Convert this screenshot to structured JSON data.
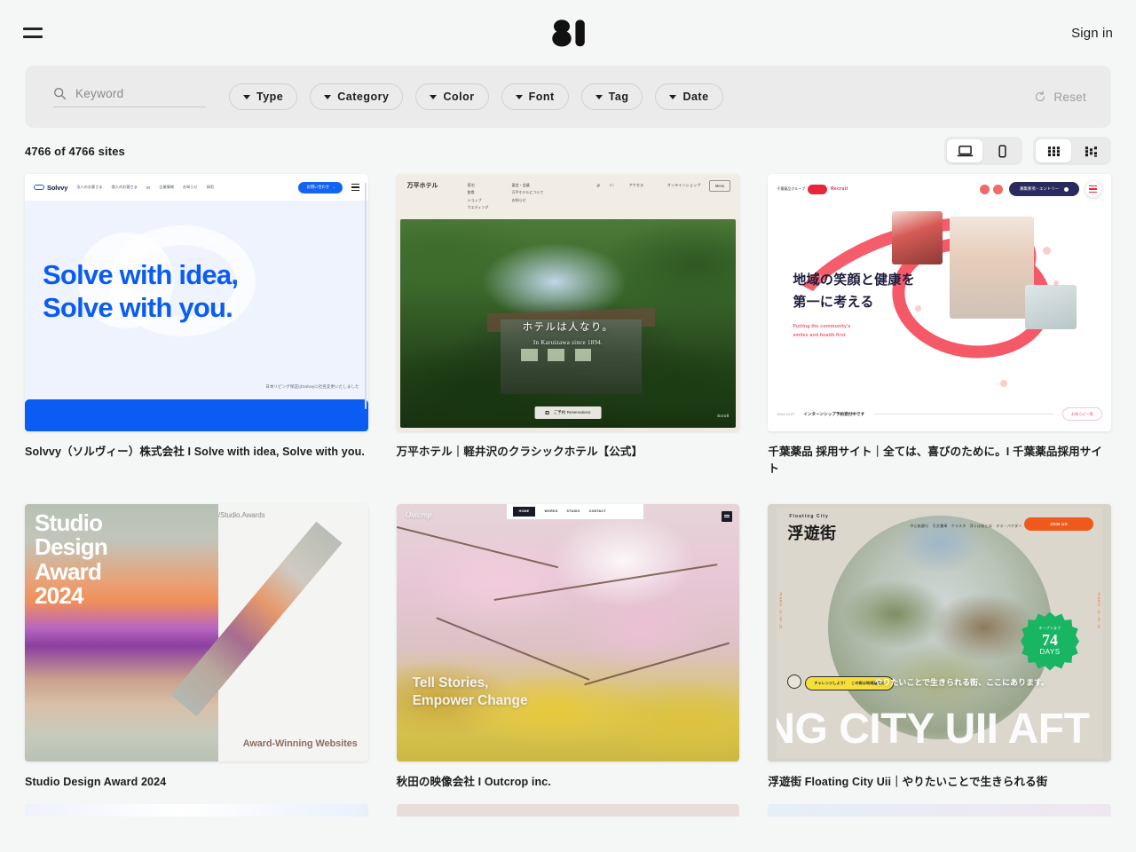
{
  "header": {
    "menu_icon": "hamburger-icon",
    "logo_text": "81",
    "signin_label": "Sign in"
  },
  "filters": {
    "search_placeholder": "Keyword",
    "search_value": "",
    "search_icon": "search-icon",
    "pills": [
      {
        "label": "Type"
      },
      {
        "label": "Category"
      },
      {
        "label": "Color"
      },
      {
        "label": "Font"
      },
      {
        "label": "Tag"
      },
      {
        "label": "Date"
      }
    ],
    "reset_label": "Reset",
    "reset_icon": "refresh-icon"
  },
  "results": {
    "count_text": "4766 of 4766 sites",
    "device_toggle": [
      {
        "icon": "desktop-icon",
        "active": true
      },
      {
        "icon": "mobile-icon",
        "active": false
      }
    ],
    "layout_toggle": [
      {
        "icon": "grid-icon",
        "active": true
      },
      {
        "icon": "masonry-icon",
        "active": false
      }
    ]
  },
  "colors": {
    "page_bg": "#f5f6f6",
    "filter_bar_bg": "#ebebeb",
    "text": "#1d1d1d",
    "muted": "#9d9d9d",
    "accent_blue": "#0b5cf2",
    "accent_red": "#f4505f",
    "accent_green": "#18b562",
    "accent_orange": "#f0591c"
  },
  "cards": [
    {
      "caption": "Solvvy（ソルヴィー）株式会社 I Solve with idea, Solve with you.",
      "site": {
        "brand": "Solvvy",
        "nav": [
          "法人のお客さま",
          "個人のお客さま",
          "IR",
          "企業情報",
          "お知らせ",
          "採用"
        ],
        "cta": "お問い合わせ",
        "headline_line1": "Solve with idea,",
        "headline_line2": "Solve with you.",
        "note": "日本リビング保証はSolvvyに社名変更いたしました"
      }
    },
    {
      "caption": "万平ホテル｜軽井沢のクラシックホテル【公式】",
      "site": {
        "brand": "万平ホテル",
        "nav_col1": [
          "宿泊",
          "飲食",
          "ショップ",
          "ウエディング"
        ],
        "nav_col2": [
          "宴会・会議",
          "万平ホテルについて",
          "お知らせ"
        ],
        "nav_right": [
          "jp",
          "En",
          "アクセス",
          "オンラインショップ"
        ],
        "menu_label": "Menu",
        "headline_jp": "ホテルは人なり。",
        "headline_en": "In Karuizawa since 1894.",
        "reservation_label": "ご予約 Reservations",
        "scroll_label": "Scroll"
      }
    },
    {
      "caption": "千葉薬品 採用サイト｜全ては、喜びのために。I 千葉薬品採用サイト",
      "site": {
        "brand": "千葉薬品グループ",
        "brand_sub": "Recruit",
        "entry_label": "募集要項・エントリー",
        "headline_line1": "地域の笑顔と健康を",
        "headline_line2": "第一に考える",
        "sub_line1": "Putting the community's",
        "sub_line2": "smiles and health first",
        "news_date": "2024.10.07",
        "news_title": "インターンシップ予約受付中です",
        "news_more": "お知らせ一覧"
      }
    },
    {
      "caption": "Studio Design Award 2024",
      "site": {
        "title_lines": [
          "Studio",
          "Design",
          "Award",
          "2024"
        ],
        "label": "/Studio.Awards",
        "footer": "Award-Winning Websites"
      }
    },
    {
      "caption": "秋田の映像会社 I Outcrop inc.",
      "site": {
        "brand": "Outcrop",
        "nav": [
          "HOME",
          "WORKS",
          "STUDIO",
          "CONTACT"
        ],
        "headline_line1": "Tell Stories,",
        "headline_line2": "Empower Change"
      }
    },
    {
      "caption": "浮遊街 Floating City Uii｜やりたいことで生きられる街",
      "site": {
        "brand_en": "Floating City",
        "brand_jp": "浮遊街",
        "nav": [
          "中心街銀行",
          "引文書庫",
          "クラスタ",
          "浮くは街とは",
          "ヲラ・バクダー"
        ],
        "join_label": "JOIN US",
        "badge_top": "オープンまで",
        "badge_number": "74",
        "badge_unit": "DAYS",
        "tagline": "やりたいことで生きられる街、ここにあります。",
        "big_text": "NG CITY UII AFT",
        "yellow_note": "チャレンジしよう！　この街は地域通貨だ",
        "side_text": "74 DAYS · 13 : 04 : 22"
      }
    }
  ]
}
